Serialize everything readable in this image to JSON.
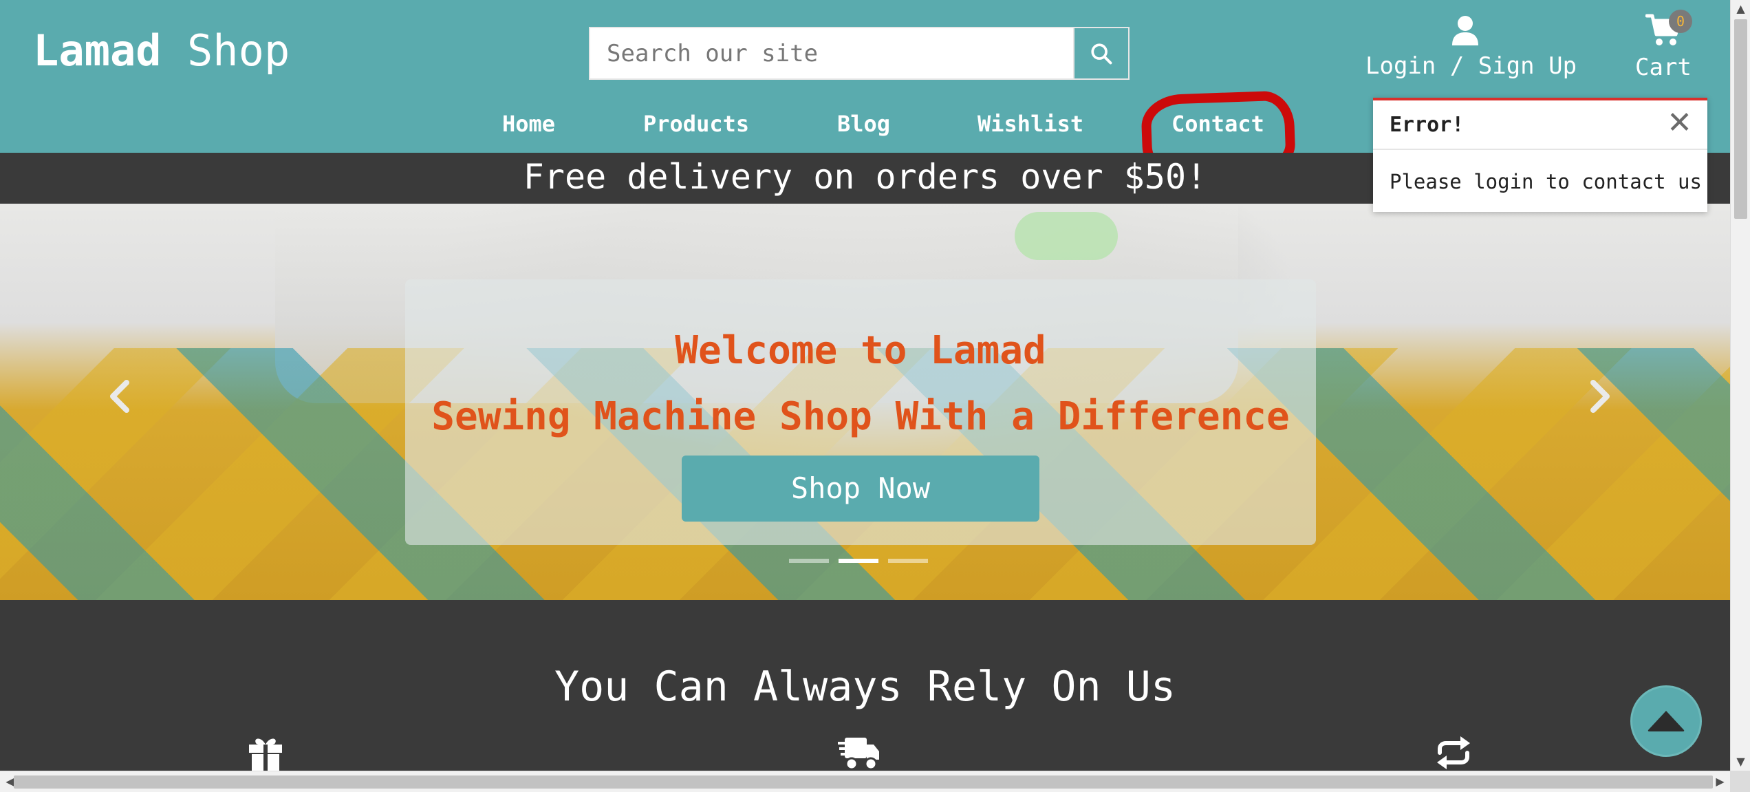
{
  "header": {
    "brand_bold": "Lamad",
    "brand_light": "Shop",
    "search_placeholder": "Search our site",
    "login_label": "Login / Sign Up",
    "cart_label": "Cart",
    "cart_count": "0",
    "bg_color": "#5aabae"
  },
  "nav": {
    "items": [
      {
        "label": "Home"
      },
      {
        "label": "Products"
      },
      {
        "label": "Blog"
      },
      {
        "label": "Wishlist"
      },
      {
        "label": "Contact"
      }
    ],
    "highlighted": "Contact"
  },
  "promo": {
    "text": "Free delivery on orders over $50!"
  },
  "hero": {
    "title_line1": "Welcome to Lamad",
    "title_line2": "Sewing Machine Shop With a Difference",
    "cta_label": "Shop Now",
    "slide_count": 3,
    "active_slide": 2,
    "title_color": "#e0531b"
  },
  "section": {
    "title": "You Can Always Rely On Us",
    "feature_icons": [
      "gift-icon",
      "delivery-truck-icon",
      "exchange-icon"
    ]
  },
  "toast": {
    "title": "Error!",
    "message": "Please login to contact us",
    "accent_color": "#d9302c"
  },
  "annotation": {
    "color": "#cc0a0a",
    "target": "Contact"
  }
}
